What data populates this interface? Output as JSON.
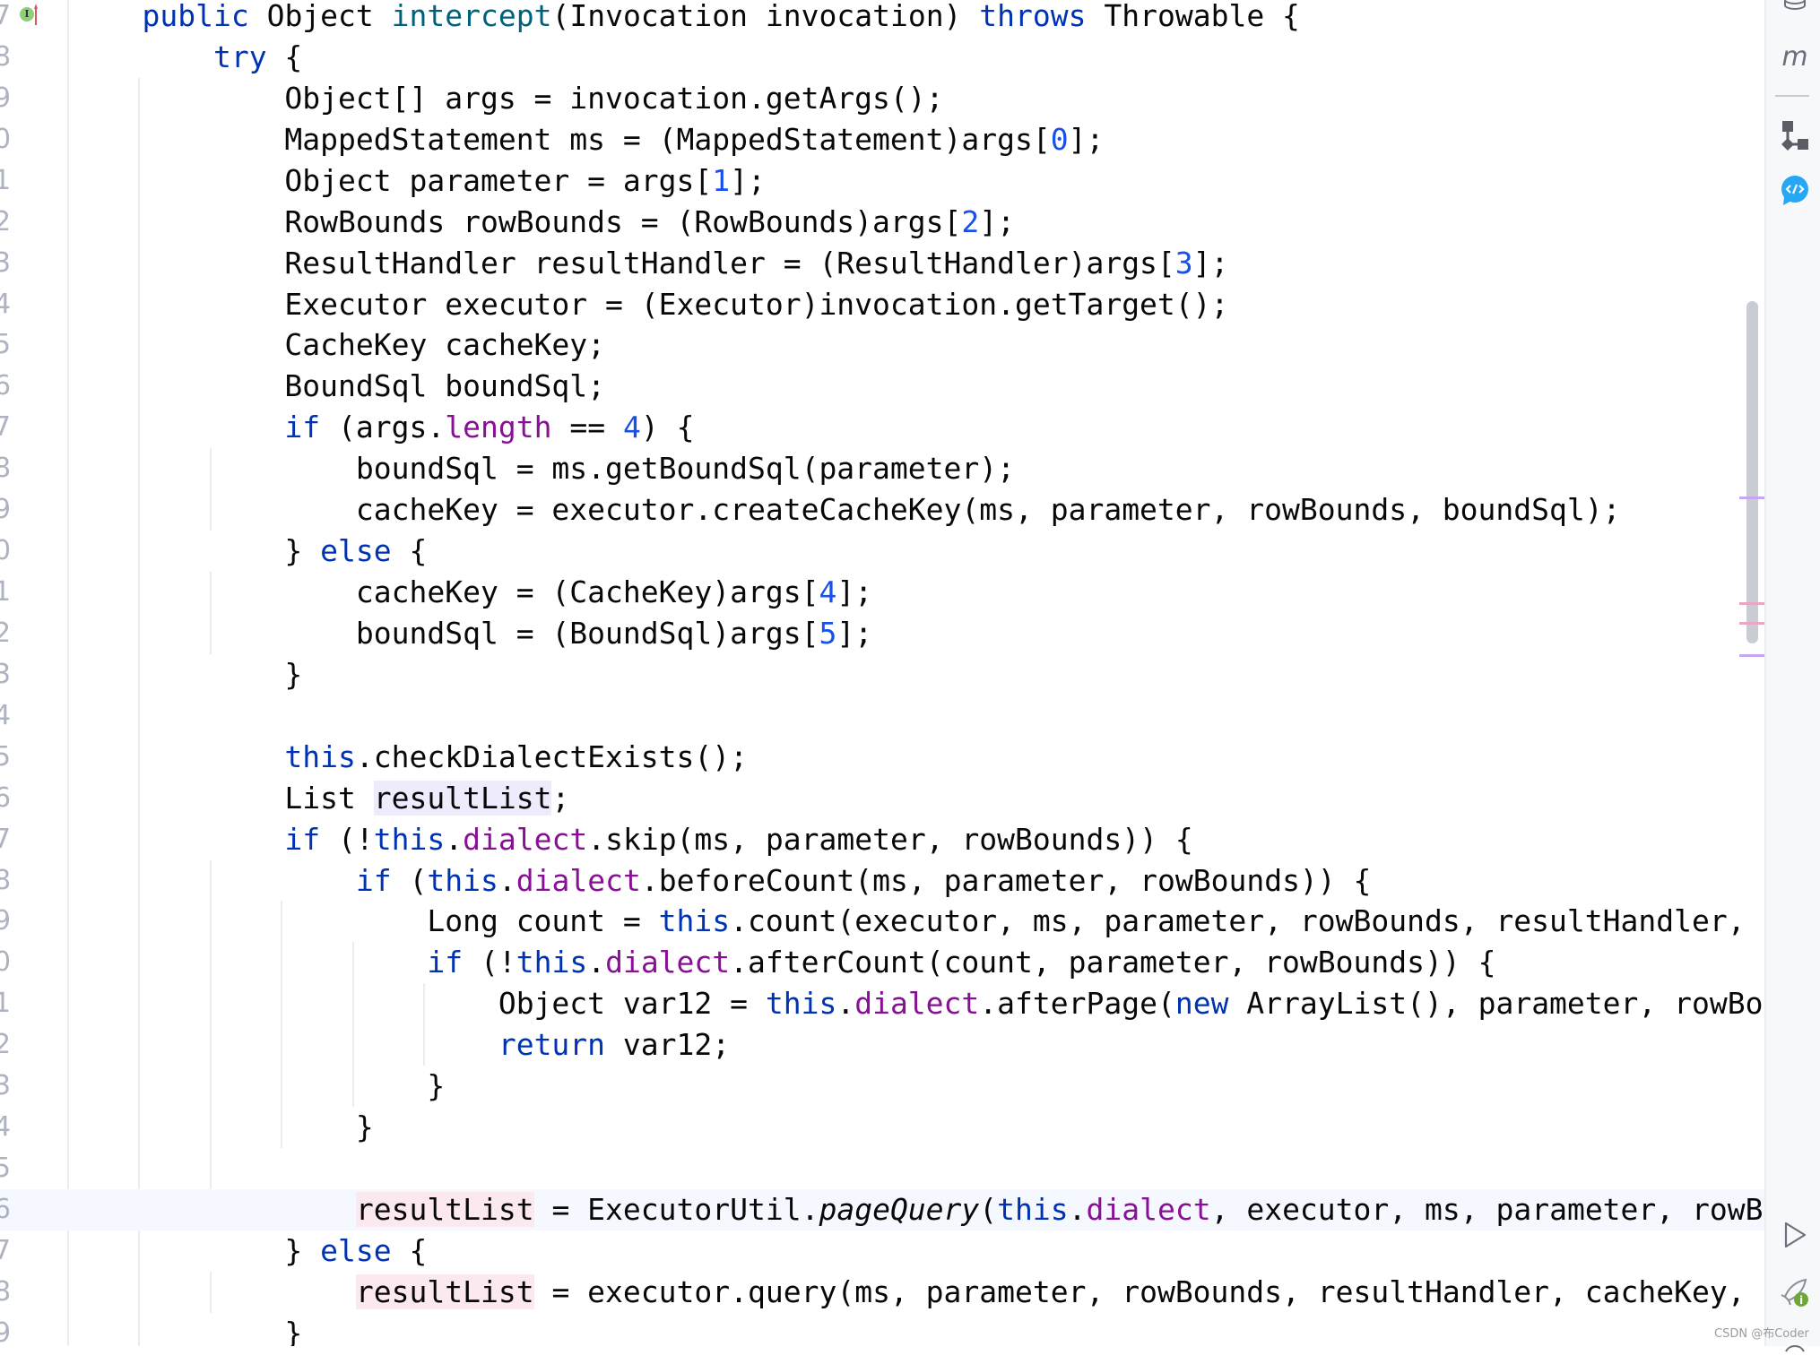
{
  "editor": {
    "first_line_number_digit": 7,
    "current_line_index": 29,
    "lines": [
      [
        [
          "    "
        ],
        [
          "public",
          "kw"
        ],
        [
          " Object "
        ],
        [
          "intercept",
          "decl"
        ],
        [
          "(Invocation invocation) "
        ],
        [
          "throws",
          "kw"
        ],
        [
          " Throwable {"
        ]
      ],
      [
        [
          "        "
        ],
        [
          "try",
          "kw"
        ],
        [
          " {"
        ]
      ],
      [
        [
          "            Object[] args = invocation.getArgs();"
        ]
      ],
      [
        [
          "            MappedStatement ms = (MappedStatement)args["
        ],
        [
          "0",
          "num"
        ],
        [
          "];"
        ]
      ],
      [
        [
          "            Object parameter = args["
        ],
        [
          "1",
          "num"
        ],
        [
          "];"
        ]
      ],
      [
        [
          "            RowBounds rowBounds = (RowBounds)args["
        ],
        [
          "2",
          "num"
        ],
        [
          "];"
        ]
      ],
      [
        [
          "            ResultHandler resultHandler = (ResultHandler)args["
        ],
        [
          "3",
          "num"
        ],
        [
          "];"
        ]
      ],
      [
        [
          "            Executor executor = (Executor)invocation.getTarget();"
        ]
      ],
      [
        [
          "            CacheKey cacheKey;"
        ]
      ],
      [
        [
          "            BoundSql boundSql;"
        ]
      ],
      [
        [
          "            "
        ],
        [
          "if",
          "kw"
        ],
        [
          " (args."
        ],
        [
          "length",
          "fld"
        ],
        [
          " == "
        ],
        [
          "4",
          "num"
        ],
        [
          ") {"
        ]
      ],
      [
        [
          "                boundSql = ms.getBoundSql(parameter);"
        ]
      ],
      [
        [
          "                cacheKey = executor.createCacheKey(ms, parameter, rowBounds, boundSql);"
        ]
      ],
      [
        [
          "            } "
        ],
        [
          "else",
          "kw"
        ],
        [
          " {"
        ]
      ],
      [
        [
          "                cacheKey = (CacheKey)args["
        ],
        [
          "4",
          "num"
        ],
        [
          "];"
        ]
      ],
      [
        [
          "                boundSql = (BoundSql)args["
        ],
        [
          "5",
          "num"
        ],
        [
          "];"
        ]
      ],
      [
        [
          "            }"
        ]
      ],
      [
        [
          ""
        ]
      ],
      [
        [
          "            "
        ],
        [
          "this",
          "kw"
        ],
        [
          ".checkDialectExists();"
        ]
      ],
      [
        [
          "            List "
        ],
        [
          "resultList",
          "hl-purple"
        ],
        [
          ";"
        ]
      ],
      [
        [
          "            "
        ],
        [
          "if",
          "kw"
        ],
        [
          " (!"
        ],
        [
          "this",
          "kw"
        ],
        [
          "."
        ],
        [
          "dialect",
          "fld"
        ],
        [
          ".skip(ms, parameter, rowBounds)) {"
        ]
      ],
      [
        [
          "                "
        ],
        [
          "if",
          "kw"
        ],
        [
          " ("
        ],
        [
          "this",
          "kw"
        ],
        [
          "."
        ],
        [
          "dialect",
          "fld"
        ],
        [
          ".beforeCount(ms, parameter, rowBounds)) {"
        ]
      ],
      [
        [
          "                    Long count = "
        ],
        [
          "this",
          "kw"
        ],
        [
          ".count(executor, ms, parameter, rowBounds, resultHandler,"
        ]
      ],
      [
        [
          "                    "
        ],
        [
          "if",
          "kw"
        ],
        [
          " (!"
        ],
        [
          "this",
          "kw"
        ],
        [
          "."
        ],
        [
          "dialect",
          "fld"
        ],
        [
          ".afterCount(count, parameter, rowBounds)) {"
        ]
      ],
      [
        [
          "                        Object var12 = "
        ],
        [
          "this",
          "kw"
        ],
        [
          "."
        ],
        [
          "dialect",
          "fld"
        ],
        [
          ".afterPage("
        ],
        [
          "new",
          "kw"
        ],
        [
          " ArrayList(), parameter, rowBo"
        ]
      ],
      [
        [
          "                        "
        ],
        [
          "return",
          "kw"
        ],
        [
          " var12;"
        ]
      ],
      [
        [
          "                    }"
        ]
      ],
      [
        [
          "                }"
        ]
      ],
      [
        [
          ""
        ]
      ],
      [
        [
          "                "
        ],
        [
          "resultList",
          "hl-pink"
        ],
        [
          " = ExecutorUtil."
        ],
        [
          "pageQuery",
          "ital"
        ],
        [
          "("
        ],
        [
          "this",
          "kw"
        ],
        [
          "."
        ],
        [
          "dialect",
          "fld"
        ],
        [
          ", executor, ms, parameter, rowB"
        ]
      ],
      [
        [
          "            } "
        ],
        [
          "else",
          "kw"
        ],
        [
          " {"
        ]
      ],
      [
        [
          "                "
        ],
        [
          "resultList",
          "hl-pink"
        ],
        [
          " = executor.query(ms, parameter, rowBounds, resultHandler, cacheKey,"
        ]
      ],
      [
        [
          "            }"
        ]
      ]
    ]
  },
  "gutter_icons": [
    "implements-icon",
    "override-up-arrow-icon"
  ],
  "right_panel": {
    "icons": [
      "database-icon",
      "maven-m-icon",
      "structure-icon",
      "code-chat-icon",
      "run-icon",
      "rocket-info-icon"
    ],
    "m_label": "m"
  },
  "colors": {
    "keyword": "#0033b3",
    "number": "#1750eb",
    "field": "#871094",
    "method_decl": "#00627a",
    "current_line": "#f5f8fe"
  },
  "watermark": "CSDN @布Coder"
}
